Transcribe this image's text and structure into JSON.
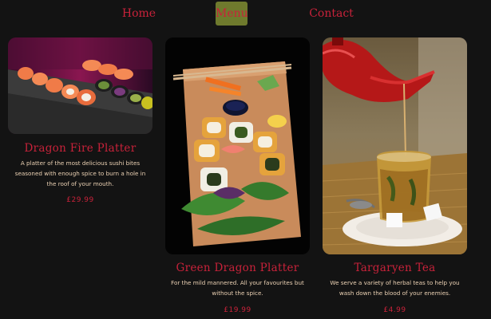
{
  "nav": {
    "home": "Home",
    "menu": "Menu",
    "contact": "Contact"
  },
  "colors": {
    "accent": "#c8223a",
    "active_nav_bg": "#6f7a2d",
    "background": "#131313"
  },
  "cards": [
    {
      "title": "Dragon Fire Platter",
      "description": "A platter of the most delicious sushi bites seasoned with enough spice to burn a hole in the roof of your mouth.",
      "price": "£29.99",
      "image": "sushi-rolls-photo"
    },
    {
      "title": "Green Dragon Platter",
      "description": "For the mild mannered. All your favourites but without the spice.",
      "price": "£19.99",
      "image": "sushi-board-photo"
    },
    {
      "title": "Targaryen Tea",
      "description": "We serve a variety of herbal teas to help you wash down the blood of your enemies.",
      "price": "£4.99",
      "image": "teapot-pouring-photo"
    }
  ]
}
